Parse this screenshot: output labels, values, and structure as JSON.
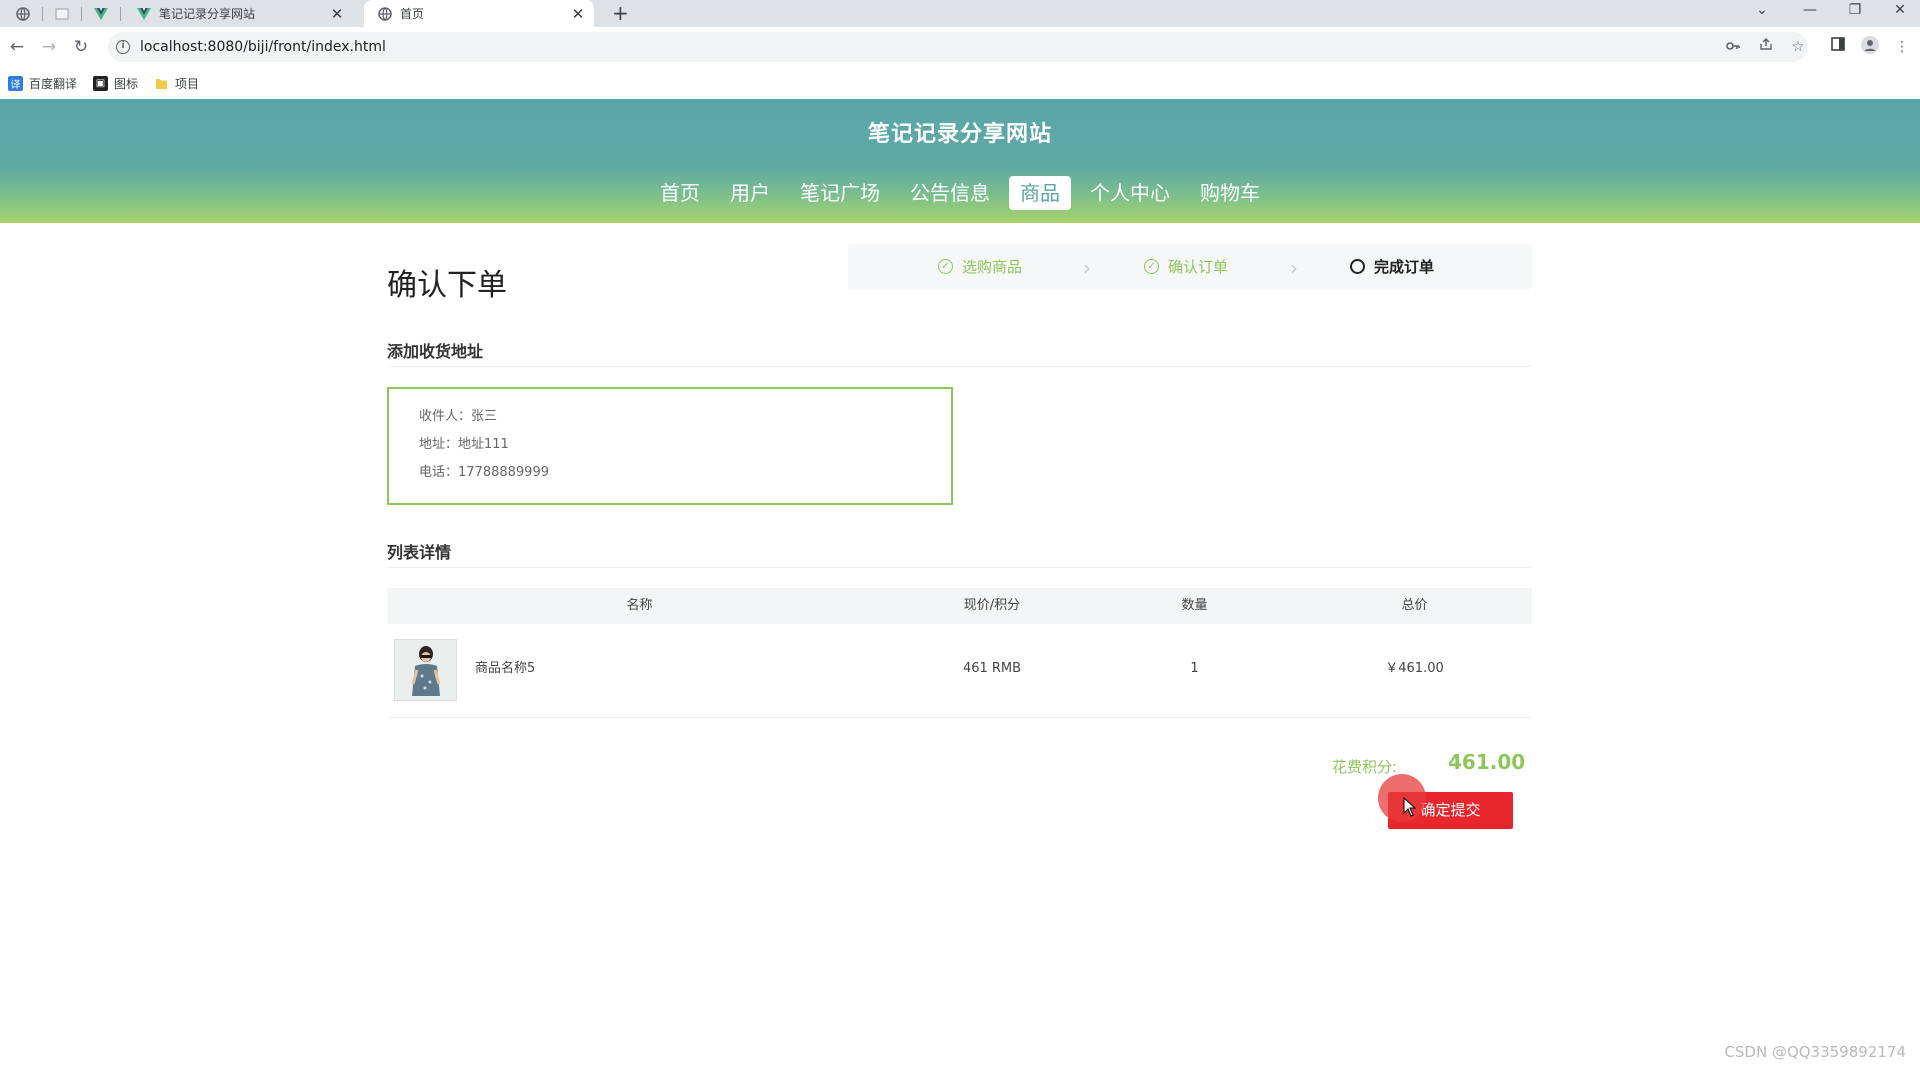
{
  "browser": {
    "tabs": [
      {
        "label": "",
        "icon": "globe-icon"
      },
      {
        "label": "",
        "icon": "blank-page-icon"
      },
      {
        "label": "",
        "icon": "vue-logo-icon"
      },
      {
        "label": "笔记记录分享网站",
        "icon": "vue-logo-icon"
      },
      {
        "label": "首页",
        "icon": "globe-icon",
        "active": true
      }
    ],
    "close_glyph": "✕",
    "new_tab_glyph": "+",
    "url": "localhost:8080/biji/front/index.html",
    "bookmarks": [
      {
        "label": "百度翻译",
        "icon": "translate-icon",
        "color": "#2f7de1",
        "glyph": "译"
      },
      {
        "label": "图标",
        "icon": "bookmark-image-icon",
        "color": "#222222",
        "glyph": "▣"
      },
      {
        "label": "项目",
        "icon": "folder-icon",
        "color": "#f3c94b",
        "glyph": ""
      }
    ]
  },
  "site": {
    "title": "笔记记录分享网站",
    "nav": [
      "首页",
      "用户",
      "笔记广场",
      "公告信息",
      "商品",
      "个人中心",
      "购物车"
    ],
    "active_nav": "商品",
    "colors": {
      "header_top": "#5aa6a8",
      "header_bottom": "#a9d36a",
      "accent_green": "#8fc65b",
      "submit_red": "#e8272d"
    }
  },
  "page": {
    "title": "确认下单",
    "steps": [
      {
        "label": "选购商品",
        "status": "done"
      },
      {
        "label": "确认订单",
        "status": "done"
      },
      {
        "label": "完成订单",
        "status": "pending"
      }
    ],
    "address_section_title": "添加收货地址",
    "address": {
      "recipient": "收件人：张三",
      "address": "地址：地址111",
      "phone": "电话：17788889999"
    },
    "list_section_title": "列表详情",
    "table": {
      "headers": [
        "名称",
        "现价/积分",
        "数量",
        "总价"
      ],
      "rows": [
        {
          "name": "商品名称5",
          "price": "461 RMB",
          "quantity": "1",
          "total": "￥461.00"
        }
      ]
    },
    "spend_label": "花费积分:",
    "spend_value": "461.00",
    "submit_label": "确定提交"
  },
  "watermark": "CSDN @QQ3359892174"
}
